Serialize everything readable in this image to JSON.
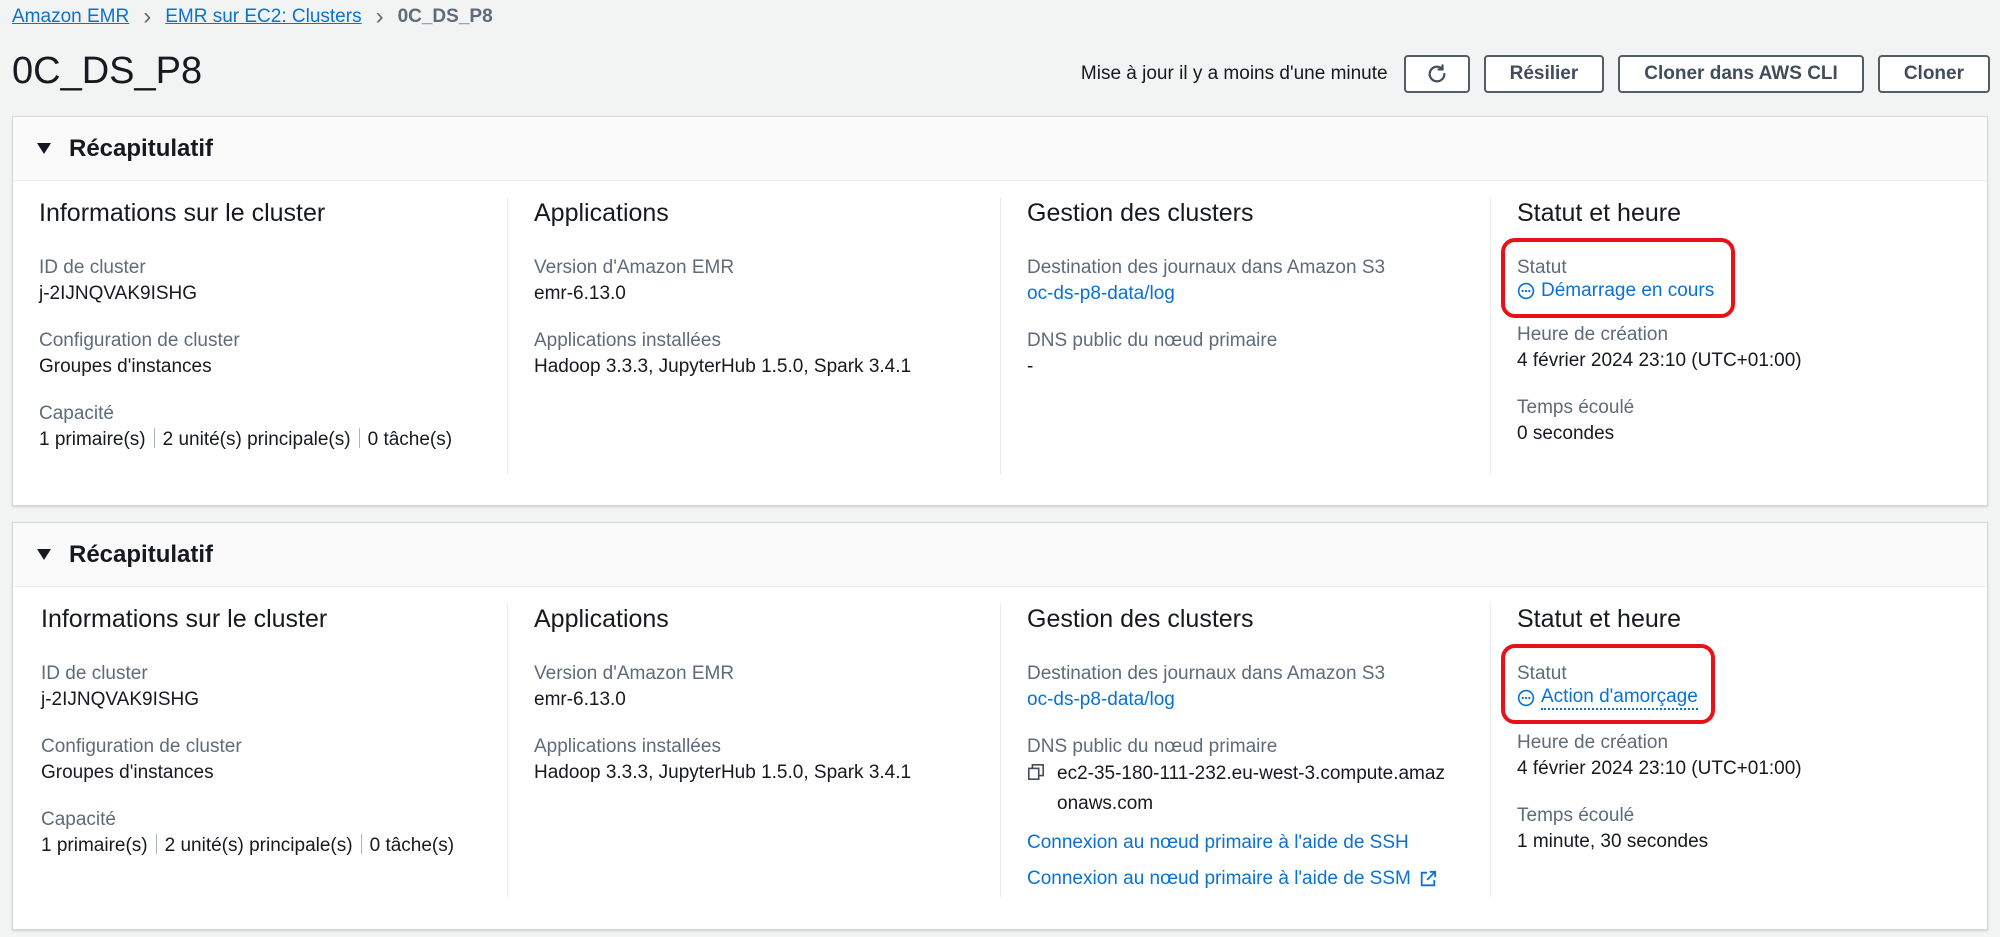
{
  "breadcrumb": {
    "items": [
      "Amazon EMR",
      "EMR sur EC2: Clusters"
    ],
    "current": "0C_DS_P8"
  },
  "page_title": "0C_DS_P8",
  "header": {
    "updated": "Mise à jour il y a moins d'une minute",
    "buttons": {
      "terminate": "Résilier",
      "clone_cli": "Cloner dans AWS CLI",
      "clone": "Cloner"
    }
  },
  "panels": [
    {
      "title": "Récapitulatif",
      "cluster_info": {
        "title": "Informations sur le cluster",
        "id_label": "ID de cluster",
        "id_value": "j-2IJNQVAK9ISHG",
        "config_label": "Configuration de cluster",
        "config_value": "Groupes d'instances",
        "capacity_label": "Capacité",
        "capacity": [
          "1 primaire(s)",
          "2 unité(s) principale(s)",
          "0 tâche(s)"
        ]
      },
      "applications": {
        "title": "Applications",
        "version_label": "Version d'Amazon EMR",
        "version_value": "emr-6.13.0",
        "installed_label": "Applications installées",
        "installed_value": "Hadoop 3.3.3, JupyterHub 1.5.0, Spark 3.4.1"
      },
      "management": {
        "title": "Gestion des clusters",
        "logs_label": "Destination des journaux dans Amazon S3",
        "logs_value": "oc-ds-p8-data/log",
        "dns_label": "DNS public du nœud primaire",
        "dns_value": "-"
      },
      "status": {
        "title": "Statut et heure",
        "status_label": "Statut",
        "status_value": "Démarrage en cours",
        "created_label": "Heure de création",
        "created_value": "4 février 2024 23:10 (UTC+01:00)",
        "elapsed_label": "Temps écoulé",
        "elapsed_value": "0 secondes"
      }
    },
    {
      "title": "Récapitulatif",
      "cluster_info": {
        "title": "Informations sur le cluster",
        "id_label": "ID de cluster",
        "id_value": "j-2IJNQVAK9ISHG",
        "config_label": "Configuration de cluster",
        "config_value": "Groupes d'instances",
        "capacity_label": "Capacité",
        "capacity": [
          "1 primaire(s)",
          "2 unité(s) principale(s)",
          "0 tâche(s)"
        ]
      },
      "applications": {
        "title": "Applications",
        "version_label": "Version d'Amazon EMR",
        "version_value": "emr-6.13.0",
        "installed_label": "Applications installées",
        "installed_value": "Hadoop 3.3.3, JupyterHub 1.5.0, Spark 3.4.1"
      },
      "management": {
        "title": "Gestion des clusters",
        "logs_label": "Destination des journaux dans Amazon S3",
        "logs_value": "oc-ds-p8-data/log",
        "dns_label": "DNS public du nœud primaire",
        "dns_value_line1": "ec2-35-180-111-232.eu-west-3.compute.amaz",
        "dns_value_line2": "onaws.com",
        "ssh_link": "Connexion au nœud primaire à l'aide de SSH",
        "ssm_link": "Connexion au nœud primaire à l'aide de SSM"
      },
      "status": {
        "title": "Statut et heure",
        "status_label": "Statut",
        "status_value": "Action d'amorçage",
        "created_label": "Heure de création",
        "created_value": "4 février 2024 23:10 (UTC+01:00)",
        "elapsed_label": "Temps écoulé",
        "elapsed_value": "1 minute, 30 secondes"
      }
    }
  ],
  "colors": {
    "link": "#0972d3",
    "highlight": "#e8111a"
  },
  "icons": [
    "chevron-right-icon",
    "refresh-icon",
    "caret-down-icon",
    "ellipsis-circle-icon",
    "copy-icon",
    "external-link-icon"
  ]
}
